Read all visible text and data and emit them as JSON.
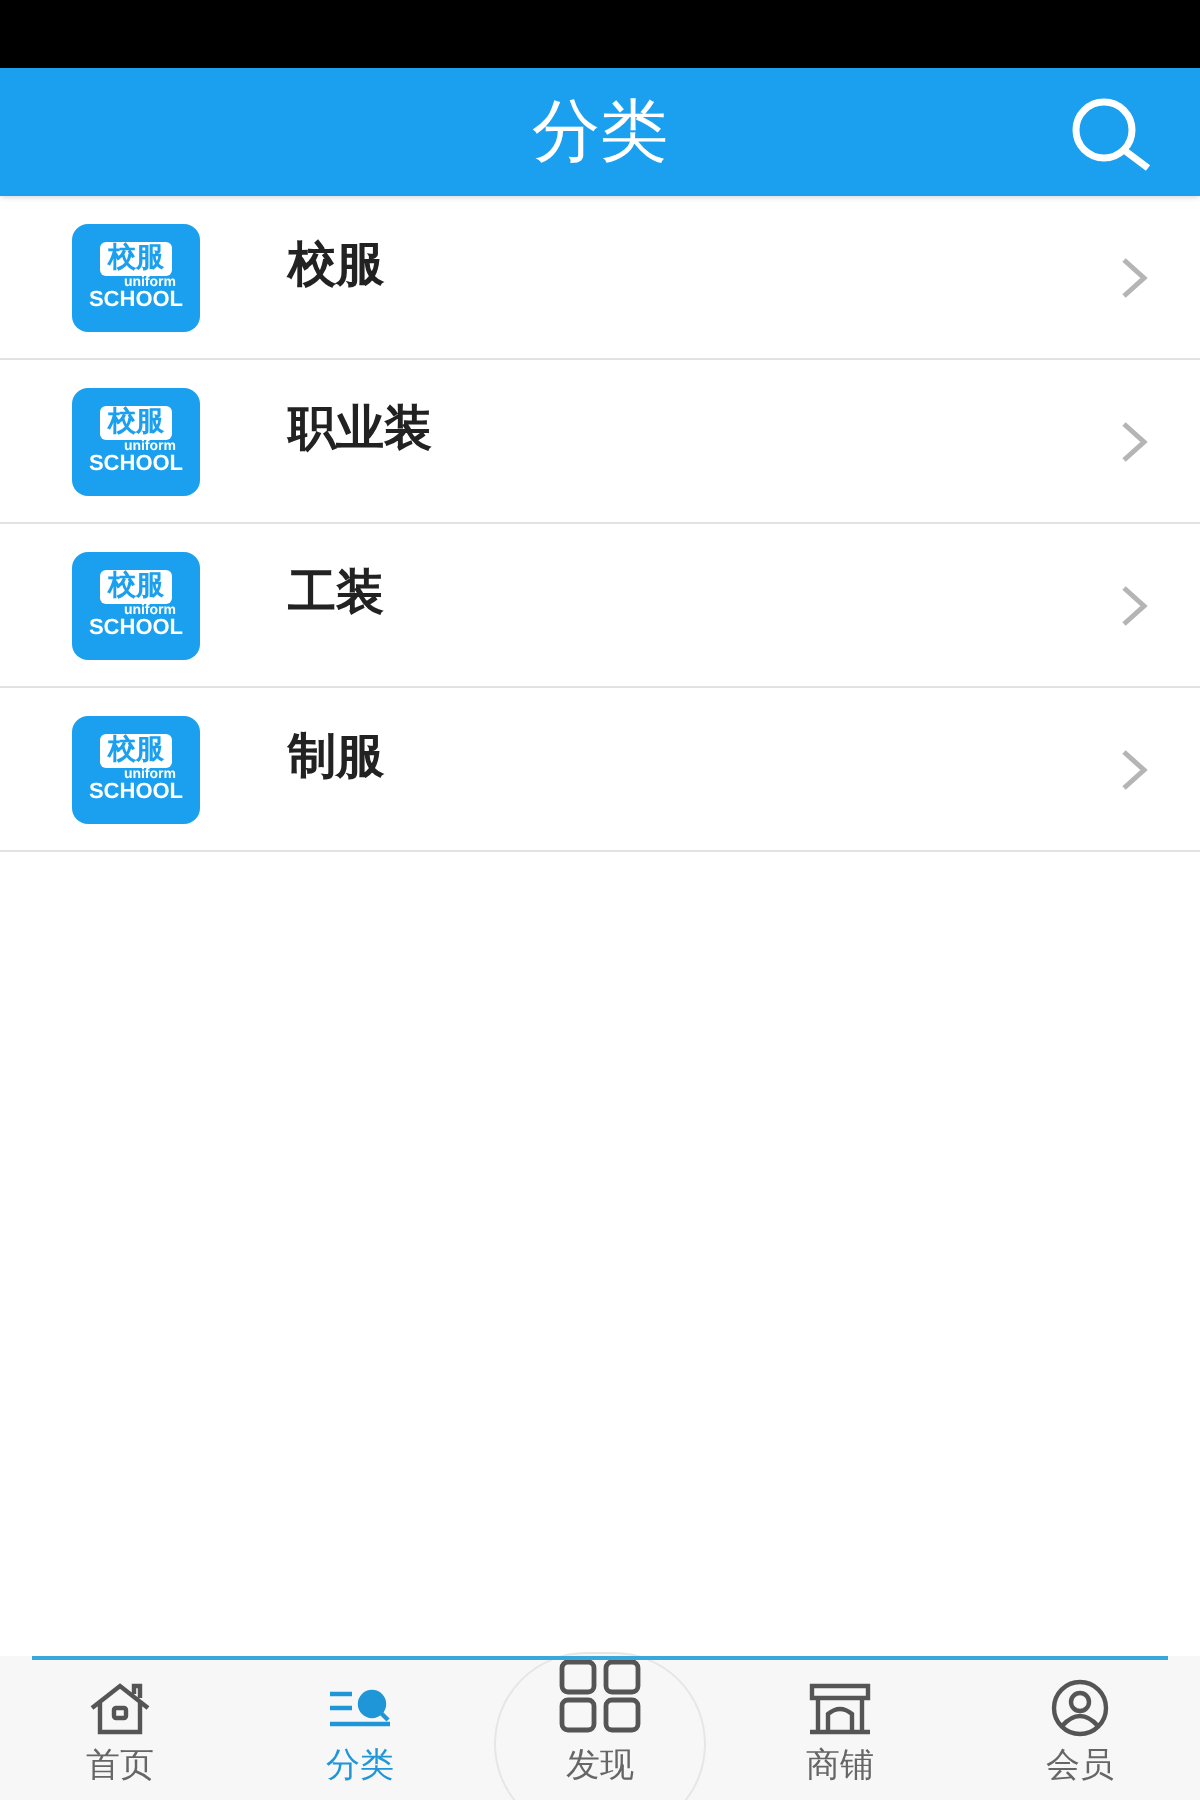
{
  "header": {
    "title": "分类"
  },
  "categories": [
    {
      "name": "校服",
      "logo": {
        "title": "校服",
        "sub": "uniform",
        "main": "SCHOOL"
      }
    },
    {
      "name": "职业装",
      "logo": {
        "title": "校服",
        "sub": "uniform",
        "main": "SCHOOL"
      }
    },
    {
      "name": "工装",
      "logo": {
        "title": "校服",
        "sub": "uniform",
        "main": "SCHOOL"
      }
    },
    {
      "name": "制服",
      "logo": {
        "title": "校服",
        "sub": "uniform",
        "main": "SCHOOL"
      }
    }
  ],
  "nav": [
    {
      "kind": "home",
      "label": "首页",
      "selected": false
    },
    {
      "kind": "category",
      "label": "分类",
      "selected": true
    },
    {
      "kind": "discover",
      "label": "发现",
      "selected": false
    },
    {
      "kind": "shop",
      "label": "商铺",
      "selected": false
    },
    {
      "kind": "member",
      "label": "会员",
      "selected": false
    }
  ]
}
